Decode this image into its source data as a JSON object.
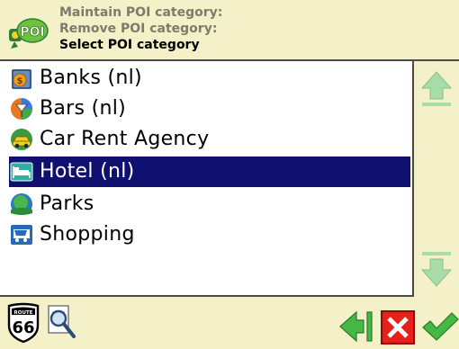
{
  "header": {
    "breadcrumb": [
      "Maintain POI category:",
      "Remove POI category:",
      "Select POI category"
    ],
    "logo_icon": "poi-logo-icon"
  },
  "list": {
    "items": [
      {
        "label": "Banks  (nl)",
        "icon": "bank-icon",
        "selected": false
      },
      {
        "label": "Bars  (nl)",
        "icon": "bar-icon",
        "selected": false
      },
      {
        "label": "Car  Rent  Agency",
        "icon": "car-rent-icon",
        "selected": false
      },
      {
        "label": "Hotel (nl)",
        "icon": "hotel-icon",
        "selected": true
      },
      {
        "label": "Parks",
        "icon": "park-icon",
        "selected": false
      },
      {
        "label": "Shopping",
        "icon": "shopping-icon",
        "selected": false
      }
    ]
  },
  "scrollbar": {
    "up_icon": "scroll-up-arrow-icon",
    "down_icon": "scroll-down-arrow-icon"
  },
  "footer": {
    "route66_icon": "route66-icon",
    "route66_text_top": "ROUTE",
    "route66_text_num": "66",
    "search_icon": "search-icon",
    "back_icon": "back-arrow-icon",
    "cancel_icon": "cancel-x-icon",
    "confirm_icon": "confirm-check-icon"
  },
  "colors": {
    "background": "#f4f0c8",
    "list_background": "#ffffff",
    "selection": "#101070",
    "header_muted_text": "#7c7c6c",
    "accent_green": "#46b846",
    "cancel_red": "#e8201c"
  }
}
